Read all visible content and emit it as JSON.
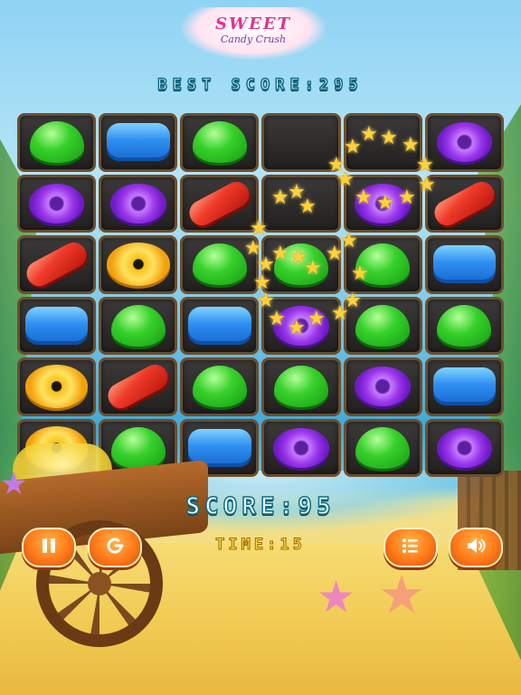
{
  "game": {
    "logo": {
      "line1": "SWEET",
      "line2": "Candy Crush"
    },
    "best_score_text": "BEST SCORE:295",
    "score_text": "SCORE:95",
    "time_text": "TIME:15",
    "board": [
      [
        "green",
        "blue",
        "green",
        "empty",
        "empty",
        "purple"
      ],
      [
        "purple",
        "purple",
        "red",
        "empty",
        "purple",
        "red"
      ],
      [
        "red",
        "yellow",
        "green",
        "green",
        "green",
        "blue"
      ],
      [
        "blue",
        "green",
        "blue",
        "purple",
        "green",
        "green"
      ],
      [
        "yellow",
        "red",
        "green",
        "green",
        "purple",
        "blue"
      ],
      [
        "yellow",
        "green",
        "blue",
        "purple",
        "green",
        "purple"
      ]
    ],
    "buttons": [
      {
        "name": "pause-button",
        "icon": "pause-icon"
      },
      {
        "name": "restart-button",
        "icon": "restart-icon"
      },
      {
        "name": "menu-button",
        "icon": "list-menu-icon"
      },
      {
        "name": "sound-button",
        "icon": "speaker-icon"
      }
    ],
    "colors": {
      "green": "#37d12b",
      "blue": "#2f8ff0",
      "purple": "#9a36ea",
      "red": "#f03b2a",
      "yellow": "#ffe260",
      "button": "#ff7b1a",
      "text_stroke": "#0f6b86"
    }
  }
}
